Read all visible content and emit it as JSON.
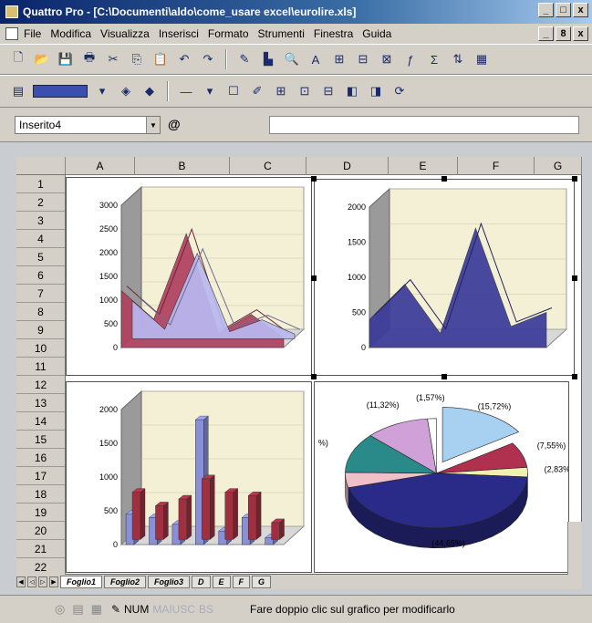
{
  "window": {
    "title": "Quattro Pro - [C:\\Documenti\\aldo\\come_usare excel\\eurolire.xls]",
    "controls": [
      "_",
      "□",
      "x"
    ]
  },
  "menu": {
    "items": [
      "File",
      "Modifica",
      "Visualizza",
      "Inserisci",
      "Formato",
      "Strumenti",
      "Finestra",
      "Guida"
    ],
    "doc_controls": [
      "_",
      "8",
      "x"
    ]
  },
  "name_box": {
    "value": "Inserito4",
    "at_symbol": "@"
  },
  "columns": [
    "A",
    "B",
    "C",
    "D",
    "E",
    "F",
    "G"
  ],
  "rows": [
    "1",
    "2",
    "3",
    "4",
    "5",
    "6",
    "7",
    "8",
    "9",
    "10",
    "11",
    "12",
    "13",
    "14",
    "15",
    "16",
    "17",
    "18",
    "19",
    "20",
    "21",
    "22"
  ],
  "sheet_tabs": [
    "Foglio1",
    "Foglio2",
    "Foglio3",
    "D",
    "E",
    "F",
    "G"
  ],
  "status": {
    "num": "NUM",
    "mai": "MAIUSC",
    "bs": "BS",
    "message": "Fare doppio clic sul grafico per modificarlo"
  },
  "chart_data": [
    {
      "type": "area",
      "ylim": [
        0,
        3000
      ],
      "yticks": [
        "3000",
        "2500",
        "2000",
        "1500",
        "1000",
        "500",
        "0"
      ],
      "series": [
        {
          "values": [
            1200,
            600,
            2400,
            300,
            700,
            200
          ],
          "color": "#b04060"
        },
        {
          "values": [
            800,
            200,
            1800,
            150,
            400,
            100
          ],
          "color": "#b8b8f0"
        }
      ]
    },
    {
      "type": "area",
      "ylim": [
        0,
        2000
      ],
      "yticks": [
        "2000",
        "1500",
        "1000",
        "500",
        "0"
      ],
      "series": [
        {
          "values": [
            400,
            900,
            200,
            1700,
            300,
            500
          ],
          "color": "#3a3a9a"
        }
      ]
    },
    {
      "type": "bar",
      "ylim": [
        0,
        2000
      ],
      "yticks": [
        "2000",
        "1500",
        "1000",
        "500",
        "0"
      ],
      "series": [
        {
          "values": [
            450,
            400,
            300,
            1850,
            200,
            400,
            100
          ],
          "color": "#8a90d8"
        },
        {
          "values": [
            700,
            500,
            600,
            900,
            700,
            650,
            250
          ],
          "color": "#a03040"
        }
      ]
    },
    {
      "type": "pie",
      "labels": [
        "(15,72%)",
        "(7,55%)",
        "(2,83%)",
        "(44,65%)",
        "",
        "%)",
        "(11,32%)",
        "(1,57%)"
      ],
      "values": [
        15.72,
        7.55,
        2.83,
        44.65,
        4.5,
        11.86,
        11.32,
        1.57
      ],
      "colors": [
        "#a8d0f0",
        "#b03050",
        "#f0f0b0",
        "#2a2a88",
        "#f0c0c8",
        "#2a8a8a",
        "#d0a0d8",
        "#ffffff"
      ]
    }
  ]
}
